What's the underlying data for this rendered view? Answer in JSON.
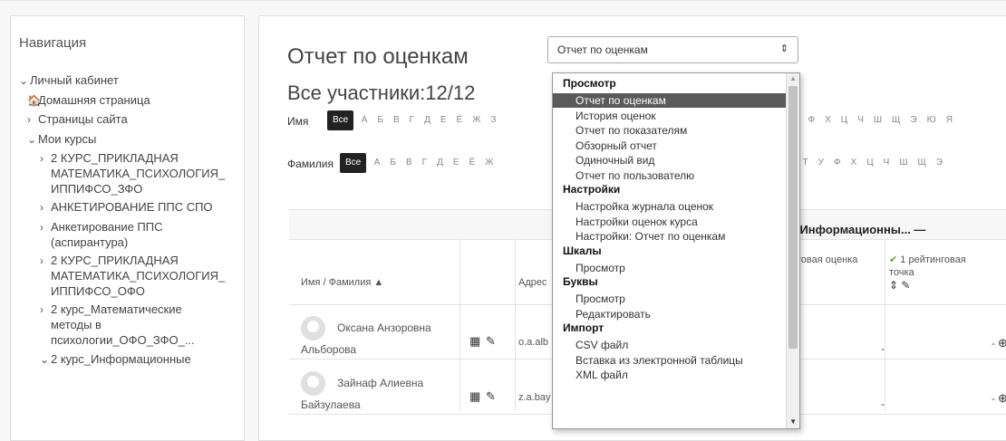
{
  "sidebar": {
    "title": "Навигация",
    "items": [
      {
        "chev": "v",
        "label": "Личный кабинет"
      },
      {
        "chev": "🏠",
        "label": "Домашняя страница"
      },
      {
        "chev": ">",
        "label": "Страницы сайта"
      },
      {
        "chev": "v",
        "label": "Мои курсы"
      },
      {
        "chev": ">",
        "label": "2 КУРС_ПРИКЛАДНАЯ"
      },
      {
        "chev": "",
        "label": "МАТЕМАТИКА_ПСИХОЛОГИЯ_"
      },
      {
        "chev": "",
        "label": "ИППИФСО_ЗФО"
      },
      {
        "chev": ">",
        "label": "АНКЕТИРОВАНИЕ ППС СПО"
      },
      {
        "chev": ">",
        "label": "Анкетирование ППС"
      },
      {
        "chev": "",
        "label": "(аспирантура)"
      },
      {
        "chev": ">",
        "label": "2 КУРС_ПРИКЛАДНАЯ"
      },
      {
        "chev": "",
        "label": "МАТЕМАТИКА_ПСИХОЛОГИЯ_"
      },
      {
        "chev": "",
        "label": "ИППИФСО_ОФО"
      },
      {
        "chev": ">",
        "label": "2 курс_Математические"
      },
      {
        "chev": "",
        "label": "методы в"
      },
      {
        "chev": "",
        "label": "психологии_ОФО_ЗФО_..."
      },
      {
        "chev": "v",
        "label": "2 курс_Информационные"
      }
    ]
  },
  "main": {
    "title": "Отчет по оценкам",
    "participants": "Все участники:12/12",
    "select_value": "Отчет по оценкам",
    "first_name_label": "Имя",
    "last_name_label": "Фамилия",
    "all_label": "Все",
    "letters_left": [
      "А",
      "Б",
      "В",
      "Г",
      "Д",
      "Е",
      "Ё",
      "Ж",
      "З"
    ],
    "letters_right": [
      "Ф",
      "Х",
      "Ц",
      "Ч",
      "Ш",
      "Щ",
      "Э",
      "Ю",
      "Я"
    ],
    "letters_left2": [
      "А",
      "Б",
      "В",
      "Г",
      "Д",
      "Е",
      "Ё",
      "Ж"
    ],
    "letters_right2": [
      "Т",
      "У",
      "Ф",
      "Х",
      "Ц",
      "Ч",
      "Ш",
      "Щ",
      "Э"
    ],
    "group_title": "с_Информационны... —",
    "headers": {
      "name": "Имя / Фамилия ▲",
      "email": "Адрес",
      "final": "тоговая оценка",
      "rating_line1": "1 рейтинговая",
      "rating_line2": "точка",
      "rating_icons": "⇕ ✎"
    },
    "rows": [
      {
        "first": "Оксана Анзоровна",
        "last": "Альборова",
        "email": "o.a.alb",
        "grade": "-",
        "rating": "-"
      },
      {
        "first": "Зайнаф Алиевна",
        "last": "Байзулаева",
        "email": "z.a.bay",
        "grade": "-",
        "rating": "-"
      }
    ]
  },
  "dropdown": {
    "groups": [
      {
        "label": "Просмотр",
        "items": [
          "Отчет по оценкам",
          "История оценок",
          "Отчет по показателям",
          "Обзорный отчет",
          "Одиночный вид",
          "Отчет по пользователю"
        ]
      },
      {
        "label": "Настройки",
        "items": [
          "Настройка журнала оценок",
          "Настройки оценок курса",
          "Настройки: Отчет по оценкам"
        ]
      },
      {
        "label": "Шкалы",
        "items": [
          "Просмотр"
        ]
      },
      {
        "label": "Буквы",
        "items": [
          "Просмотр",
          "Редактировать"
        ]
      },
      {
        "label": "Импорт",
        "items": [
          "CSV файл",
          "Вставка из электронной таблицы",
          "XML файл"
        ]
      }
    ],
    "selected": "Отчет по оценкам"
  }
}
